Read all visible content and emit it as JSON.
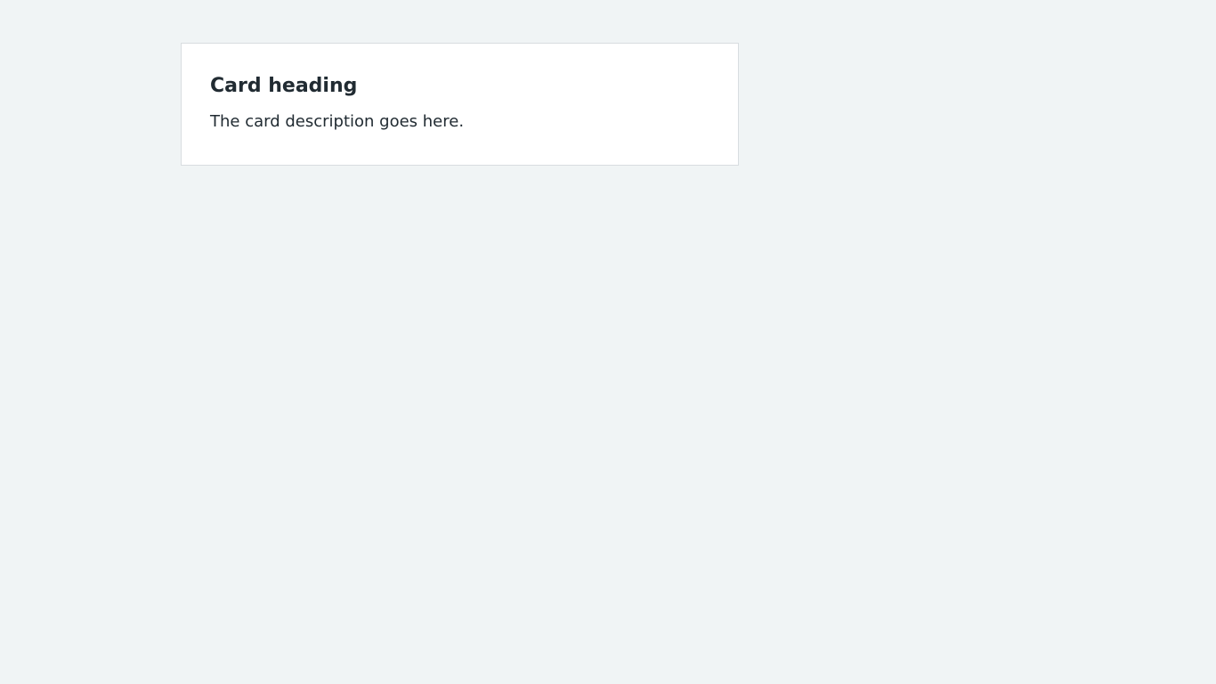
{
  "card": {
    "heading": "Card heading",
    "description": "The card description goes here."
  },
  "colors": {
    "page_background": "#f0f4f5",
    "card_background": "#ffffff",
    "card_border": "#d8dde0",
    "text": "#212b32"
  }
}
